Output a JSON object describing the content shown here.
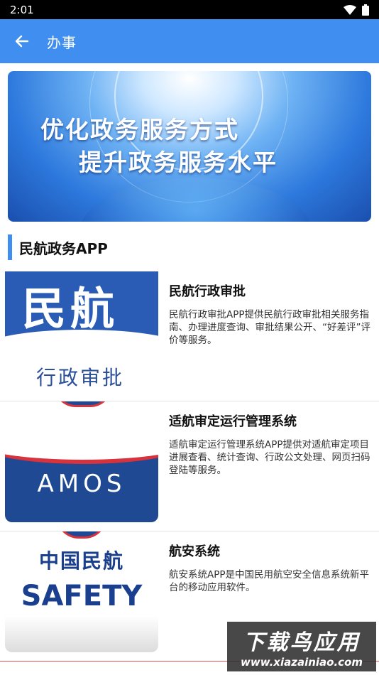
{
  "status_bar": {
    "time": "2:01"
  },
  "app_bar": {
    "title": "办事"
  },
  "banner": {
    "line1": "优化政务服务方式",
    "line2": "提升政务服务水平"
  },
  "section": {
    "title": "民航政务APP"
  },
  "apps": [
    {
      "name": "民航行政审批",
      "description": "民航行政审批APP提供民航行政审批相关服务指南、办理进度查询、审批结果公开、“好差评”评价等服务。",
      "thumb_big": "民航",
      "thumb_small": "行政审批"
    },
    {
      "name": "适航审定运行管理系统",
      "description": "适航审定运行管理系统APP提供对适航审定项目进展查看、统计查询、行政公文处理、网页扫码登陆等服务。",
      "thumb_text": "AMOS"
    },
    {
      "name": "航安系统",
      "description": "航安系统APP是中国民用航空安全信息系统新平台的移动应用软件。",
      "thumb_cn": "中国民航",
      "thumb_en": "SAFETY"
    }
  ],
  "watermark": {
    "line1": "下载鸟应用",
    "line2": "www.xiazainiao.com"
  },
  "colors": {
    "appbar": "#3f8ef0",
    "accent_bar": "#3f8ef0",
    "logo_blue": "#1f4a93",
    "logo_red": "#d8333c"
  }
}
